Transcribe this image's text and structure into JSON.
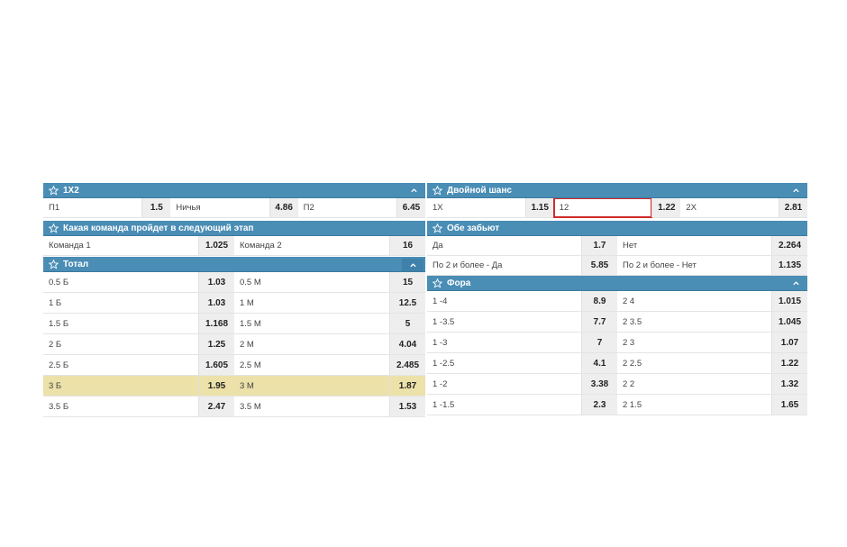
{
  "markets": {
    "m1x2": {
      "title": "1X2",
      "outcomes": [
        {
          "label": "П1",
          "odds": "1.5"
        },
        {
          "label": "Ничья",
          "odds": "4.86"
        },
        {
          "label": "П2",
          "odds": "6.45"
        }
      ]
    },
    "double_chance": {
      "title": "Двойной шанс",
      "outcomes": [
        {
          "label": "1X",
          "odds": "1.15"
        },
        {
          "label": "12",
          "odds": "1.22"
        },
        {
          "label": "2X",
          "odds": "2.81"
        }
      ]
    },
    "next_stage": {
      "title": "Какая команда пройдет в следующий этап",
      "outcomes": [
        {
          "label": "Команда 1",
          "odds": "1.025"
        },
        {
          "label": "Команда 2",
          "odds": "16"
        }
      ]
    },
    "both_score": {
      "title": "Обе забьют",
      "rows": [
        [
          {
            "label": "Да",
            "odds": "1.7"
          },
          {
            "label": "Нет",
            "odds": "2.264"
          }
        ],
        [
          {
            "label": "По 2 и более - Да",
            "odds": "5.85"
          },
          {
            "label": "По 2 и более - Нет",
            "odds": "1.135"
          }
        ]
      ]
    },
    "total": {
      "title": "Тотал",
      "rows": [
        [
          {
            "label": "0.5 Б",
            "odds": "1.03"
          },
          {
            "label": "0.5 М",
            "odds": "15"
          }
        ],
        [
          {
            "label": "1 Б",
            "odds": "1.03"
          },
          {
            "label": "1 М",
            "odds": "12.5"
          }
        ],
        [
          {
            "label": "1.5 Б",
            "odds": "1.168"
          },
          {
            "label": "1.5 М",
            "odds": "5"
          }
        ],
        [
          {
            "label": "2 Б",
            "odds": "1.25"
          },
          {
            "label": "2 М",
            "odds": "4.04"
          }
        ],
        [
          {
            "label": "2.5 Б",
            "odds": "1.605"
          },
          {
            "label": "2.5 М",
            "odds": "2.485"
          }
        ],
        [
          {
            "label": "3 Б",
            "odds": "1.95"
          },
          {
            "label": "3 М",
            "odds": "1.87"
          }
        ],
        [
          {
            "label": "3.5 Б",
            "odds": "2.47"
          },
          {
            "label": "3.5 М",
            "odds": "1.53"
          }
        ]
      ]
    },
    "handicap": {
      "title": "Фора",
      "rows": [
        [
          {
            "label": "1 -4",
            "odds": "8.9"
          },
          {
            "label": "2 4",
            "odds": "1.015"
          }
        ],
        [
          {
            "label": "1 -3.5",
            "odds": "7.7"
          },
          {
            "label": "2 3.5",
            "odds": "1.045"
          }
        ],
        [
          {
            "label": "1 -3",
            "odds": "7"
          },
          {
            "label": "2 3",
            "odds": "1.07"
          }
        ],
        [
          {
            "label": "1 -2.5",
            "odds": "4.1"
          },
          {
            "label": "2 2.5",
            "odds": "1.22"
          }
        ],
        [
          {
            "label": "1 -2",
            "odds": "3.38"
          },
          {
            "label": "2 2",
            "odds": "1.32"
          }
        ],
        [
          {
            "label": "1 -1.5",
            "odds": "2.3"
          },
          {
            "label": "2 1.5",
            "odds": "1.65"
          }
        ]
      ]
    }
  },
  "icons": {
    "favorite": "star-outline-icon",
    "collapse": "chevron-up-icon"
  },
  "colors": {
    "header_bg": "#4a8db5",
    "odds_bg": "#eeeeee",
    "highlight_row": "#ece1a9",
    "selection_outline": "#d22b2b"
  }
}
